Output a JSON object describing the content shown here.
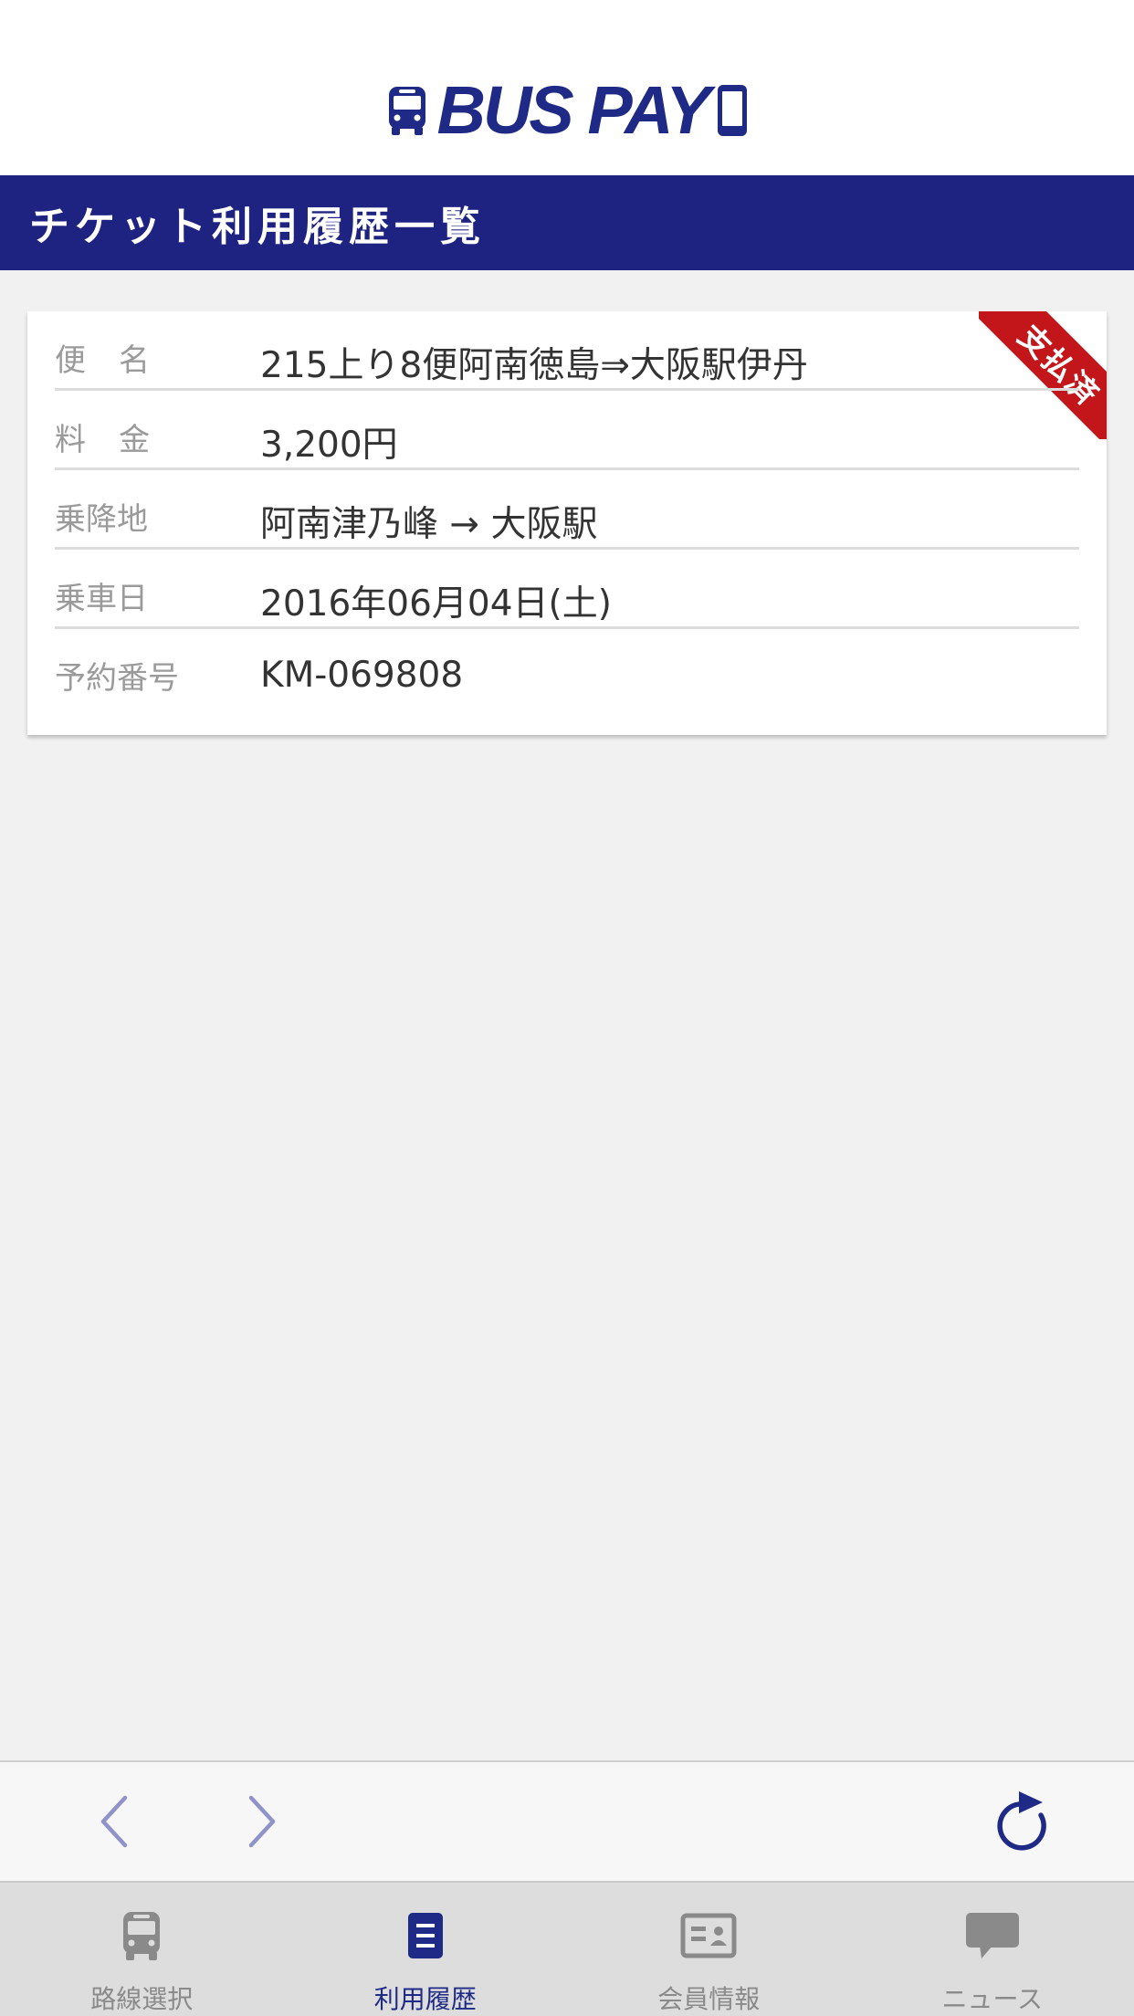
{
  "app": {
    "logo_text": "BUS PAY",
    "brand_color": "#1e2a86",
    "accent_color": "#c2161b"
  },
  "header": {
    "title": "チケット利用履歴一覧"
  },
  "ticket": {
    "status_ribbon": "支払済",
    "rows": [
      {
        "label": "便名",
        "value": "215上り8便阿南徳島⇒大阪駅伊丹"
      },
      {
        "label": "料金",
        "value": "3,200円"
      },
      {
        "label": "乗降地",
        "value": "阿南津乃峰 → 大阪駅"
      },
      {
        "label": "乗車日",
        "value": "2016年06月04日(土)"
      },
      {
        "label": "予約番号",
        "value": "KM-069808"
      }
    ]
  },
  "browser_nav": {
    "icons": [
      "chevron-left-icon",
      "chevron-right-icon",
      "reload-icon"
    ]
  },
  "tabs": [
    {
      "label": "路線選択",
      "icon": "bus-icon",
      "active": false
    },
    {
      "label": "利用履歴",
      "icon": "history-list-icon",
      "active": true
    },
    {
      "label": "会員情報",
      "icon": "member-card-icon",
      "active": false
    },
    {
      "label": "ニュース",
      "icon": "chat-bubble-icon",
      "active": false
    }
  ]
}
